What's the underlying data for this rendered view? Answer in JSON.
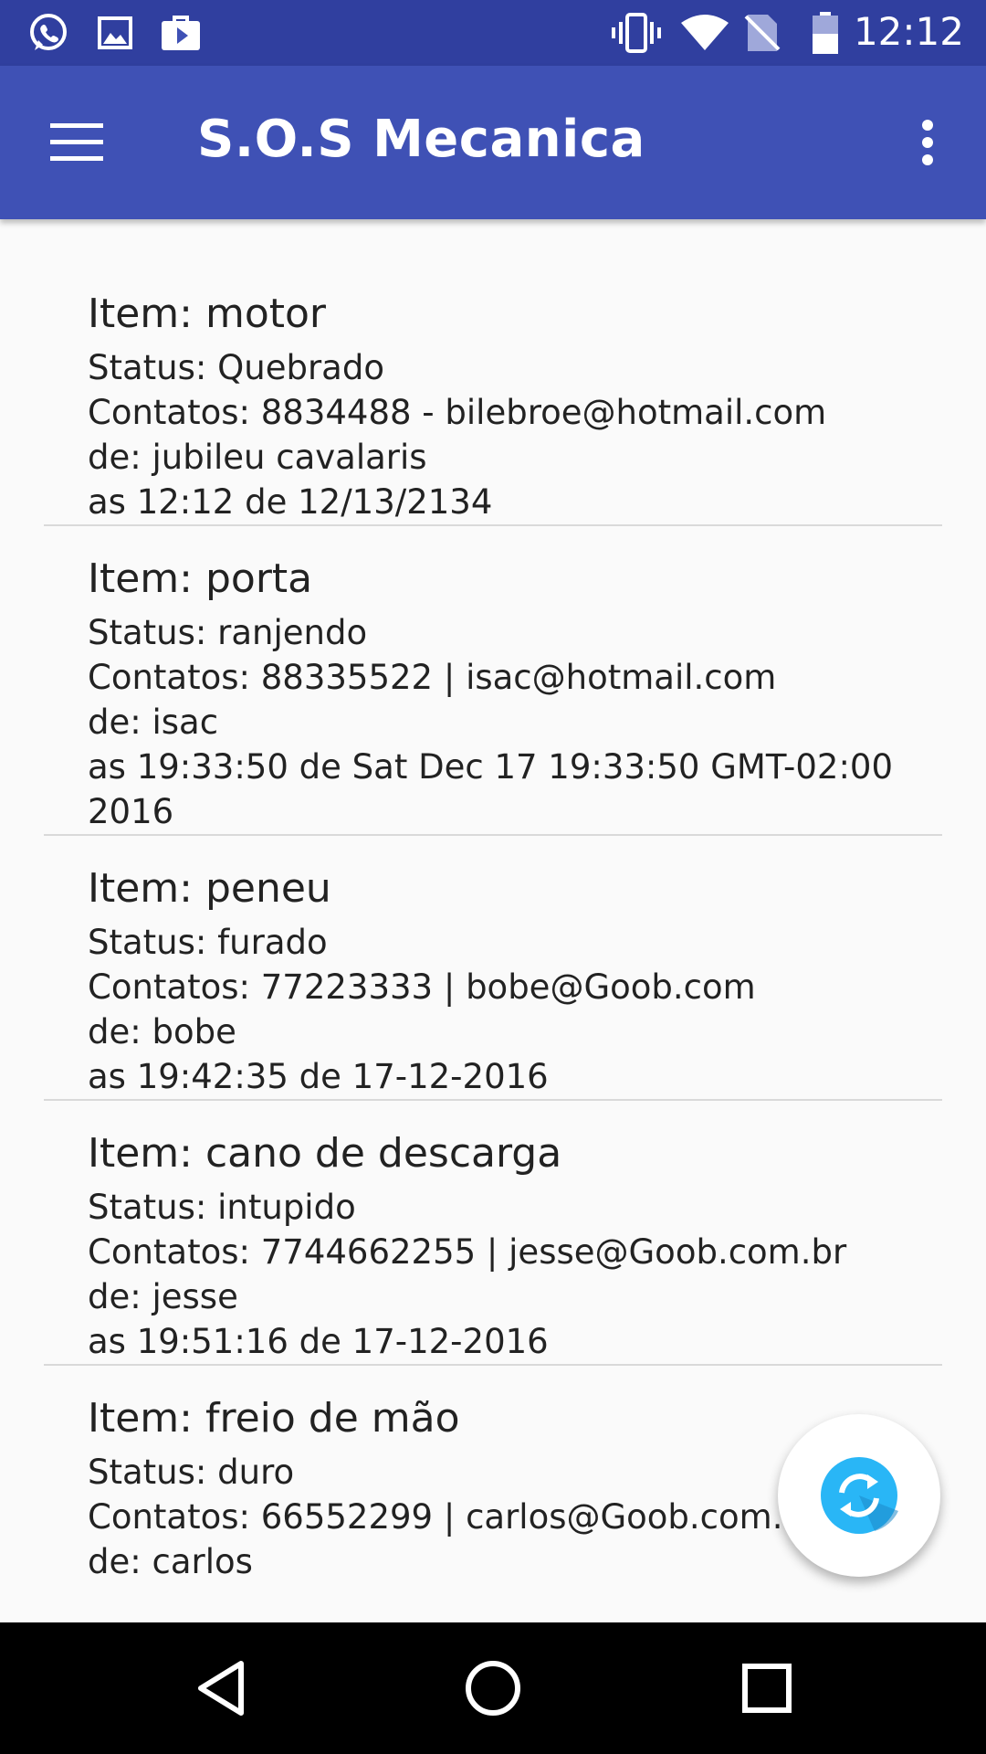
{
  "status_bar": {
    "time": "12:12",
    "left_icons": [
      "whatsapp-icon",
      "image-icon",
      "play-store-icon"
    ],
    "right_icons": [
      "vibrate-icon",
      "wifi-icon",
      "no-sim-icon",
      "battery-icon"
    ]
  },
  "app_bar": {
    "title": "S.O.S Mecanica",
    "menu_icon": "hamburger-menu-icon",
    "overflow_icon": "more-vert-icon"
  },
  "items": [
    {
      "title": "Item: motor",
      "status": "Status: Quebrado",
      "contacts": "Contatos: 8834488 - bilebroe@hotmail.com",
      "from": "de: jubileu cavalaris",
      "time": "as 12:12 de 12/13/2134"
    },
    {
      "title": "Item: porta",
      "status": "Status: ranjendo",
      "contacts": "Contatos: 88335522 | isac@hotmail.com",
      "from": "de: isac",
      "time": "as 19:33:50 de Sat Dec 17 19:33:50 GMT-02:00 2016"
    },
    {
      "title": "Item: peneu",
      "status": "Status: furado",
      "contacts": "Contatos: 77223333 | bobe@Goob.com",
      "from": "de: bobe",
      "time": "as 19:42:35 de 17-12-2016"
    },
    {
      "title": "Item: cano de descarga",
      "status": "Status: intupido",
      "contacts": "Contatos: 7744662255 | jesse@Goob.com.br",
      "from": "de: jesse",
      "time": "as 19:51:16 de 17-12-2016"
    },
    {
      "title": "Item: freio de mão",
      "status": "Status: duro",
      "contacts": "Contatos: 66552299 | carlos@Goob.com.br",
      "from": "de: carlos",
      "time": ""
    }
  ],
  "fab": {
    "icon": "sync-icon"
  },
  "nav_bar": {
    "icons": [
      "back-icon",
      "home-icon",
      "recents-icon"
    ]
  },
  "colors": {
    "status_bar": "#303f9f",
    "app_bar": "#3f51b5",
    "fab_icon": "#29b6f6",
    "background": "#fafafa"
  }
}
